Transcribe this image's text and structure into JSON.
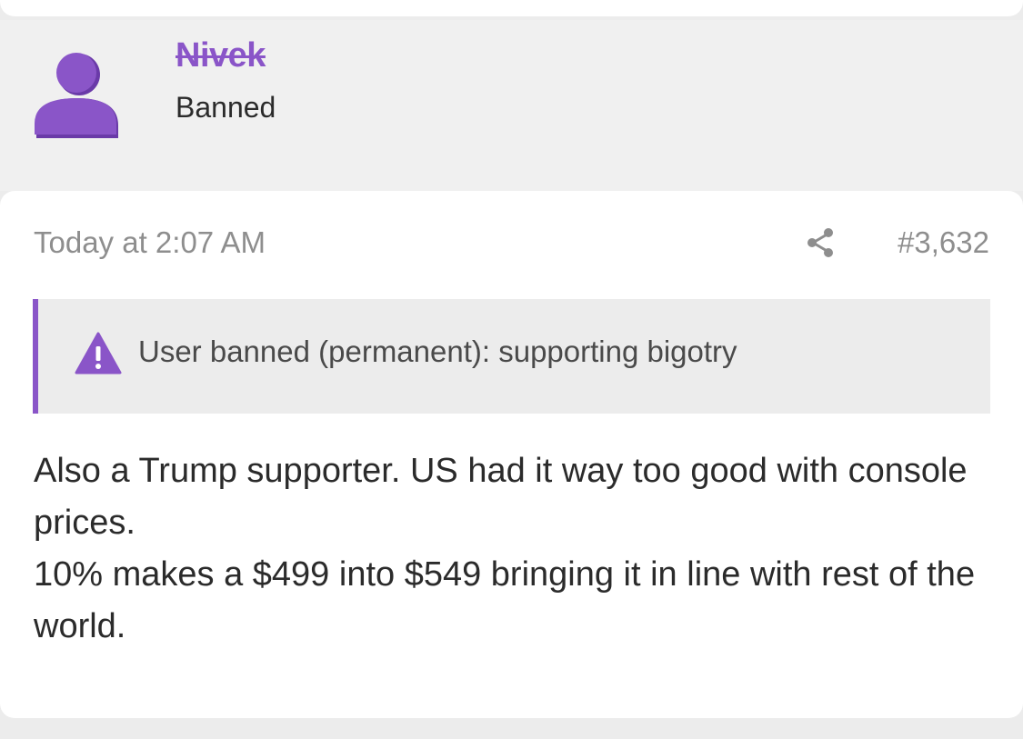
{
  "user": {
    "name": "Nivek",
    "title": "Banned"
  },
  "post": {
    "timestamp": "Today at 2:07 AM",
    "number": "#3,632",
    "ban_notice": "User banned (permanent): supporting bigotry",
    "body": [
      "Also a Trump supporter. US had it way too good with console prices.",
      "10% makes a $499 into $549 bringing it in line with rest of the world."
    ]
  },
  "icons": {
    "avatar": "user-silhouette-icon",
    "share": "share-icon",
    "warning": "warning-triangle-icon"
  },
  "colors": {
    "accent": "#8a55c8",
    "page_background": "#ececec",
    "card_background": "#ffffff",
    "muted_text": "#8e8e8e",
    "body_text": "#2b2b2b"
  }
}
